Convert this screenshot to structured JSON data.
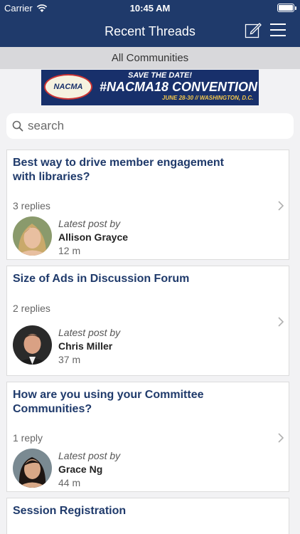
{
  "status_bar": {
    "carrier": "Carrier",
    "time": "10:45 AM"
  },
  "nav": {
    "title": "Recent Threads"
  },
  "community_filter": "All Communities",
  "banner": {
    "logo_text": "NACMA",
    "save_the_date": "SAVE THE DATE!",
    "headline": "#NACMA18 CONVENTION",
    "dates": "JUNE 28-30 // WASHINGTON, D.C."
  },
  "search": {
    "placeholder": "search"
  },
  "threads": [
    {
      "title": "Best way to drive member engagement with libraries?",
      "replies": "3 replies",
      "latest_label": "Latest post by",
      "author": "Allison Grayce",
      "ago": "12 m"
    },
    {
      "title": "Size of Ads in Discussion Forum",
      "replies": "2 replies",
      "latest_label": "Latest post by",
      "author": "Chris Miller",
      "ago": "37 m"
    },
    {
      "title": "How are you using your Committee Communities?",
      "replies": "1 reply",
      "latest_label": "Latest post by",
      "author": "Grace Ng",
      "ago": "44 m"
    },
    {
      "title": "Session Registration"
    }
  ]
}
